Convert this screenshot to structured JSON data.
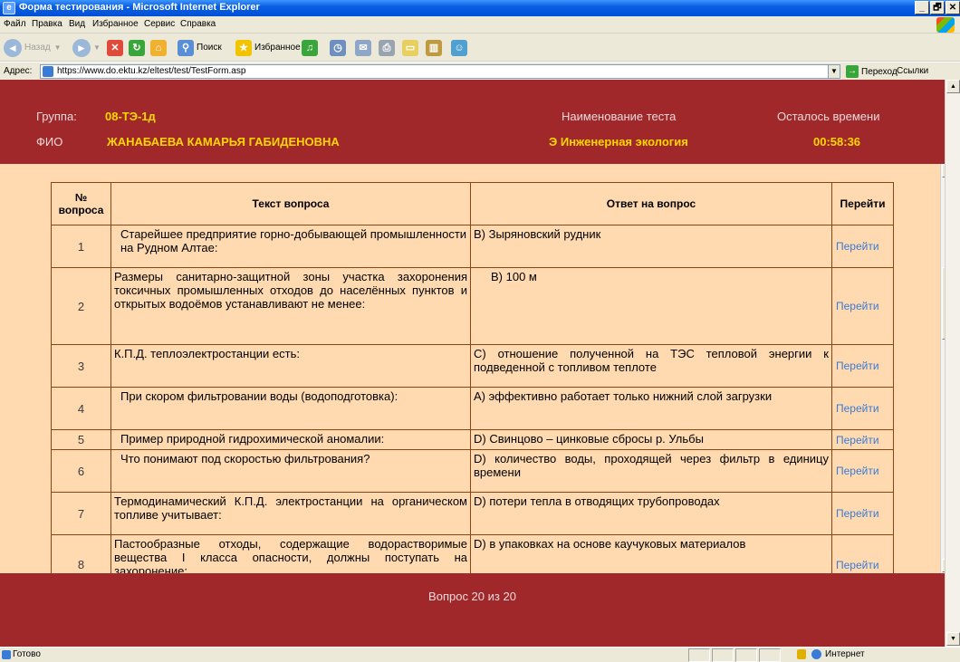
{
  "window": {
    "title": "Форма тестирования - Microsoft Internet Explorer",
    "controls": [
      "_",
      "🗗",
      "✕"
    ]
  },
  "menu": [
    "Файл",
    "Правка",
    "Вид",
    "Избранное",
    "Сервис",
    "Справка"
  ],
  "toolbar": {
    "back": "Назад",
    "search": "Поиск",
    "favorites": "Избранное"
  },
  "address": {
    "label": "Адрес:",
    "url": "https://www.do.ektu.kz/eltest/test/TestForm.asp",
    "go": "Переход",
    "links": "Ссылки"
  },
  "header": {
    "group_label": "Группа:",
    "group_value": "08-ТЭ-1д",
    "name_label": "ФИО",
    "name_value": "ЖАНАБАЕВА КАМАРЬЯ ГАБИДЕНОВНА",
    "test_label": "Наименование теста",
    "test_value": "Э Инженерная экология",
    "time_label": "Осталось времени",
    "time_value": "00:58:36"
  },
  "table": {
    "headers": {
      "num": "№ вопроса",
      "question": "Текст вопроса",
      "answer": "Ответ на вопрос",
      "goto": "Перейти"
    },
    "rows": [
      {
        "num": "1",
        "question": "Старейшее предприятие горно-добывающей промышленности на Рудном Алтае:",
        "answer": "B) Зыряновский рудник",
        "goto": "Перейти"
      },
      {
        "num": "2",
        "question": "Размеры санитарно-защитной зоны участка захоронения токсичных промышленных отходов до населённых пунктов и открытых водоёмов устанавливают не менее:",
        "answer": "B) 100 м",
        "goto": "Перейти"
      },
      {
        "num": "3",
        "question": "К.П.Д. теплоэлектростанции есть:",
        "answer": "C) отношение полученной на ТЭС тепловой энергии к подведенной с топливом теплоте",
        "goto": "Перейти"
      },
      {
        "num": "4",
        "question": "При скором фильтровании воды (водоподготовка):",
        "answer": "A) эффективно работает только нижний слой загрузки",
        "goto": "Перейти"
      },
      {
        "num": "5",
        "question": "Пример природной гидрохимической аномалии:",
        "answer": "D) Свинцово – цинковые сбросы р. Ульбы",
        "goto": "Перейти"
      },
      {
        "num": "6",
        "question": "Что понимают под скоростью фильтрования?",
        "answer": "D) количество воды, проходящей через фильтр в единицу времени",
        "goto": "Перейти"
      },
      {
        "num": "7",
        "question": "Термодинамический К.П.Д. электростанции на органическом топливе учитывает:",
        "answer": "D) потери тепла в отводящих трубопроводах",
        "goto": "Перейти"
      },
      {
        "num": "8",
        "question": "Пастообразные отходы, содержащие водорастворимые вещества I класса опасности, должны поступать на захоронение:",
        "answer": "D) в упаковках на основе каучуковых материалов",
        "goto": "Перейти"
      }
    ]
  },
  "footer": {
    "counter": "Вопрос 20 из 20"
  },
  "status": {
    "text": "Готово",
    "zone": "Интернет"
  }
}
